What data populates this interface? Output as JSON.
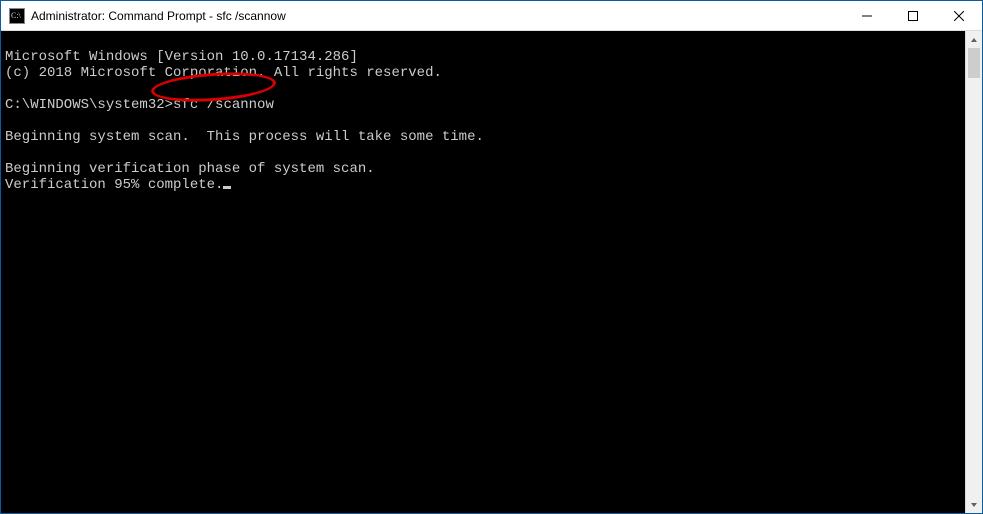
{
  "titlebar": {
    "title": "Administrator: Command Prompt - sfc  /scannow"
  },
  "console": {
    "line1": "Microsoft Windows [Version 10.0.17134.286]",
    "line2": "(c) 2018 Microsoft Corporation. All rights reserved.",
    "blank1": "",
    "prompt_path": "C:\\WINDOWS\\system32>",
    "prompt_cmd": "sfc /scannow",
    "blank2": "",
    "line_scan": "Beginning system scan.  This process will take some time.",
    "blank3": "",
    "line_phase": "Beginning verification phase of system scan.",
    "line_progress": "Verification 95% complete."
  },
  "annotation": {
    "highlight_target": "sfc /scannow"
  }
}
